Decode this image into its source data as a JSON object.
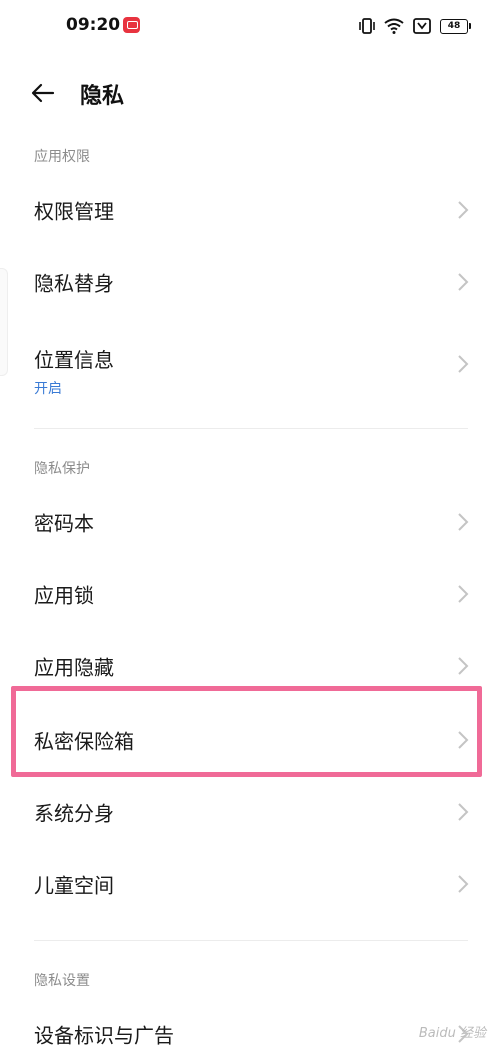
{
  "status_bar": {
    "time": "09:20",
    "app_icon": "screen-record-icon",
    "icons": [
      "vibrate-icon",
      "wifi-icon",
      "notification-box-icon",
      "battery-icon"
    ],
    "battery_level": "48"
  },
  "header": {
    "back_icon": "arrow-left-icon",
    "title": "隐私"
  },
  "sections": {
    "permissions": {
      "title": "应用权限",
      "items": [
        {
          "label": "权限管理"
        },
        {
          "label": "隐私替身"
        },
        {
          "label": "位置信息",
          "sublabel": "开启"
        }
      ]
    },
    "protection": {
      "title": "隐私保护",
      "items": [
        {
          "label": "密码本"
        },
        {
          "label": "应用锁"
        },
        {
          "label": "应用隐藏"
        },
        {
          "label": "私密保险箱"
        },
        {
          "label": "系统分身"
        },
        {
          "label": "儿童空间"
        }
      ]
    },
    "settings": {
      "title": "隐私设置",
      "items": [
        {
          "label": "设备标识与广告"
        }
      ]
    }
  },
  "colors": {
    "accent": "#3a7bd5",
    "highlight": "#f06a97",
    "secondary_text": "#8c8c8c"
  },
  "watermark": "Baidu 经验"
}
